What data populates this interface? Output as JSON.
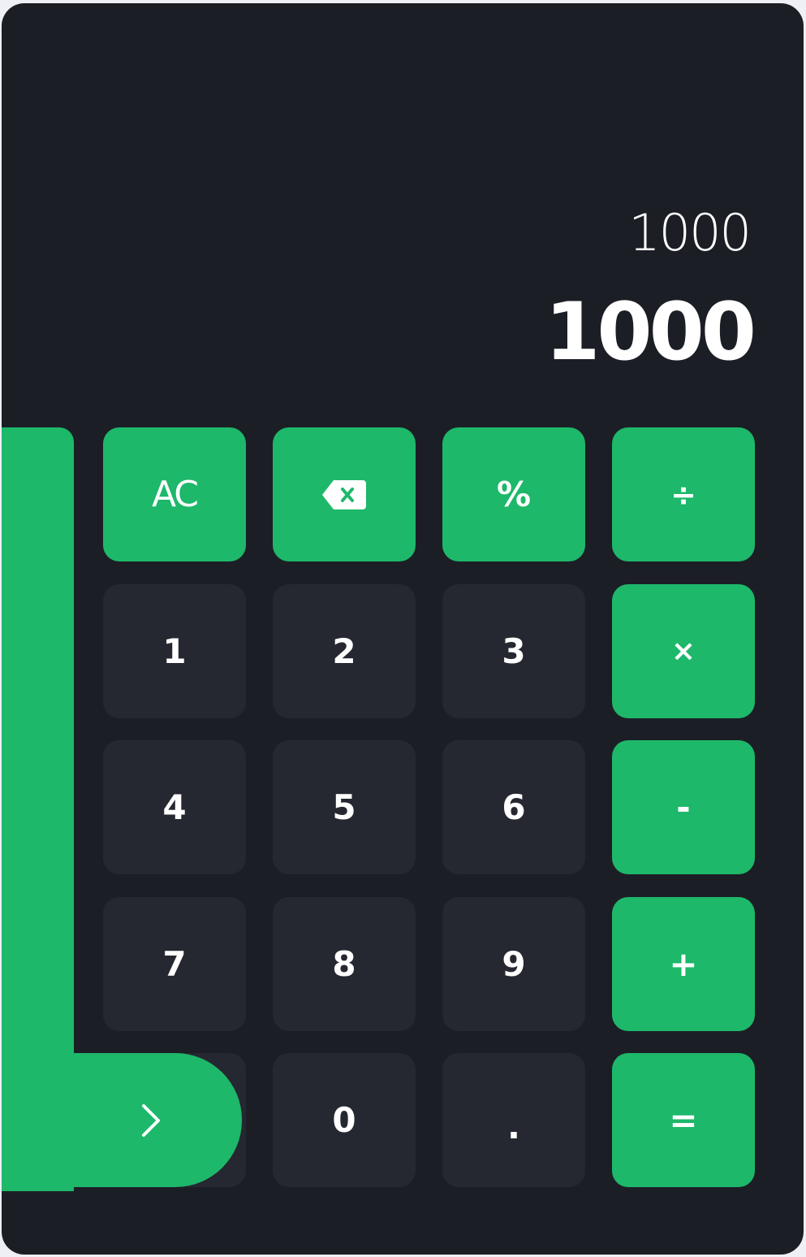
{
  "display": {
    "expression": "1000",
    "result": "1000"
  },
  "keys": {
    "ac": "AC",
    "backspace_icon": "backspace-icon",
    "percent": "%",
    "divide": "÷",
    "one": "1",
    "two": "2",
    "three": "3",
    "multiply": "×",
    "four": "4",
    "five": "5",
    "six": "6",
    "minus": "-",
    "seven": "7",
    "eight": "8",
    "nine": "9",
    "plus": "+",
    "zero": "0",
    "dot": ".",
    "equals": "="
  },
  "drawer": {
    "toggle_icon": "chevron-right-icon"
  },
  "colors": {
    "background": "#1c1e26",
    "number_key": "#252830",
    "accent": "#1db86a",
    "text": "#ffffff"
  }
}
